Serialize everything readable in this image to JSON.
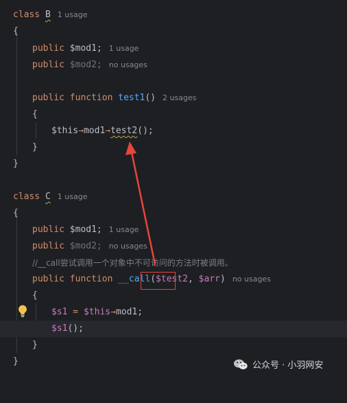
{
  "class_b": {
    "decl_keyword": "class",
    "name": "B",
    "usage_hint": "1 usage",
    "open_brace": "{",
    "prop1_keyword": "public",
    "prop1_name": "$mod1;",
    "prop1_hint": "1 usage",
    "prop2_keyword": "public",
    "prop2_name": "$mod2;",
    "prop2_hint": "no usages",
    "method_keyword_public": "public",
    "method_keyword_function": "function",
    "method_name": "test1",
    "method_parens": "()",
    "method_hint": "2 usages",
    "method_open": "{",
    "stmt_this": "$this",
    "stmt_arrow1": "→",
    "stmt_mod1": "mod1",
    "stmt_arrow2": "→",
    "stmt_call": "test2",
    "stmt_tail": "();",
    "method_close": "}",
    "close_brace": "}"
  },
  "class_c": {
    "decl_keyword": "class",
    "name": "C",
    "usage_hint": "1 usage",
    "open_brace": "{",
    "prop1_keyword": "public",
    "prop1_name": "$mod1;",
    "prop1_hint": "1 usage",
    "prop2_keyword": "public",
    "prop2_name": "$mod2;",
    "prop2_hint": "no usages",
    "comment": "//__call尝试调用一个对象中不可访问的方法时被调用。",
    "method_keyword_public": "public",
    "method_keyword_function": "function",
    "method_name": "__call",
    "paren_open": "(",
    "param1": "$test2",
    "comma": ",",
    "param2": "$arr",
    "paren_close": ")",
    "method_hint": "no usages",
    "method_open": "{",
    "stmt1_var": "$s1",
    "stmt1_eq": " = ",
    "stmt1_this": "$this",
    "stmt1_arrow": "→",
    "stmt1_prop": "mod1;",
    "stmt2_var": "$s1",
    "stmt2_tail": "();",
    "method_close": "}",
    "close_brace": "}"
  },
  "watermark": {
    "text": "公众号 · 小羽网安",
    "icon": "wechat-icon"
  },
  "colors": {
    "background": "#1e1f22",
    "keyword": "#cf8e6d",
    "variable": "#c77dbb",
    "function": "#56a8f5",
    "annotation_red": "#e8453c"
  }
}
